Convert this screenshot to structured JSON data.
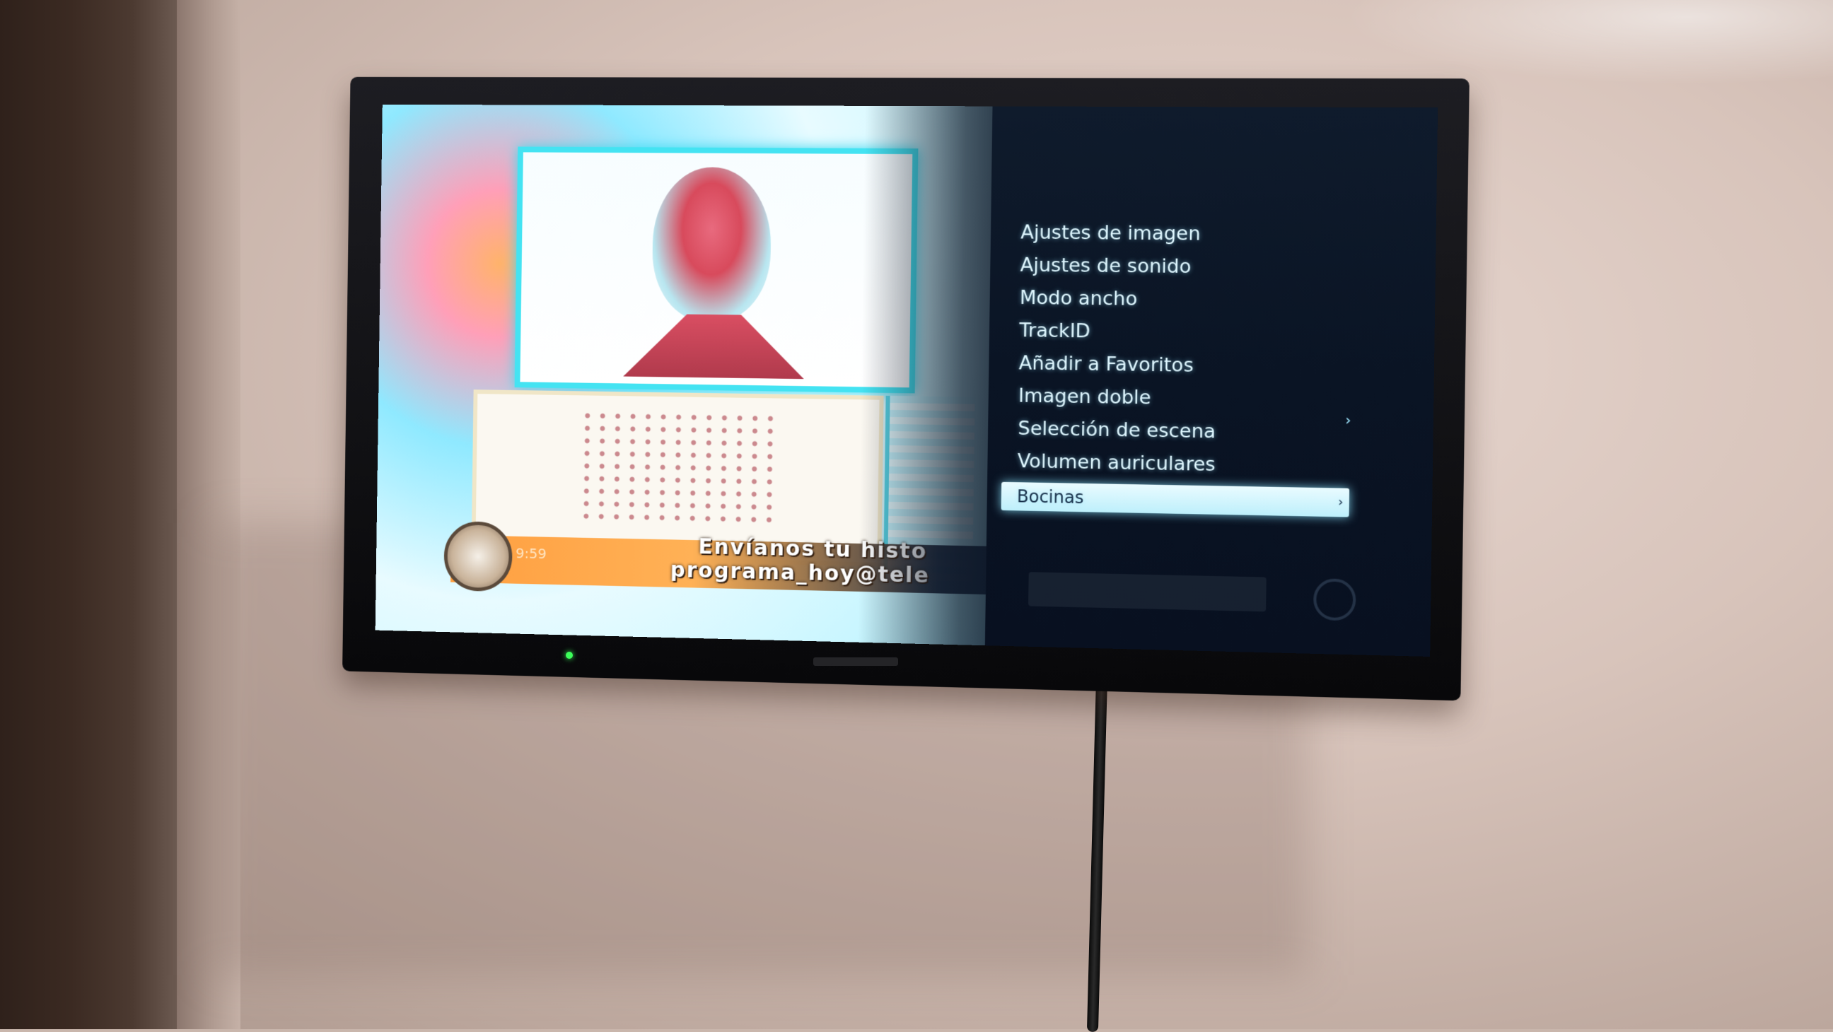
{
  "tv_menu": {
    "items": [
      {
        "label": "Ajustes de imagen",
        "selected": false,
        "has_submenu": false
      },
      {
        "label": "Ajustes de sonido",
        "selected": false,
        "has_submenu": false
      },
      {
        "label": "Modo ancho",
        "selected": false,
        "has_submenu": false
      },
      {
        "label": "TrackID",
        "selected": false,
        "has_submenu": false
      },
      {
        "label": "Añadir a Favoritos",
        "selected": false,
        "has_submenu": false
      },
      {
        "label": "Imagen doble",
        "selected": false,
        "has_submenu": true
      },
      {
        "label": "Selección de escena",
        "selected": false,
        "has_submenu": false
      },
      {
        "label": "Volumen auriculares",
        "selected": false,
        "has_submenu": false
      },
      {
        "label": "Bocinas",
        "selected": true,
        "has_submenu": true
      }
    ],
    "arrow_glyph": "›"
  },
  "program": {
    "ticker_time": "9:59",
    "ticker_line1": "Envíanos tu histo",
    "ticker_line2": "programa_hoy@tele"
  },
  "colors": {
    "menu_background": "#0a1424",
    "menu_text": "#dff7ff",
    "selected_background": "#d6f6ff",
    "selected_text": "#17304a",
    "ticker_orange": "#ff9f40",
    "frame_cyan": "#44e3f2"
  }
}
